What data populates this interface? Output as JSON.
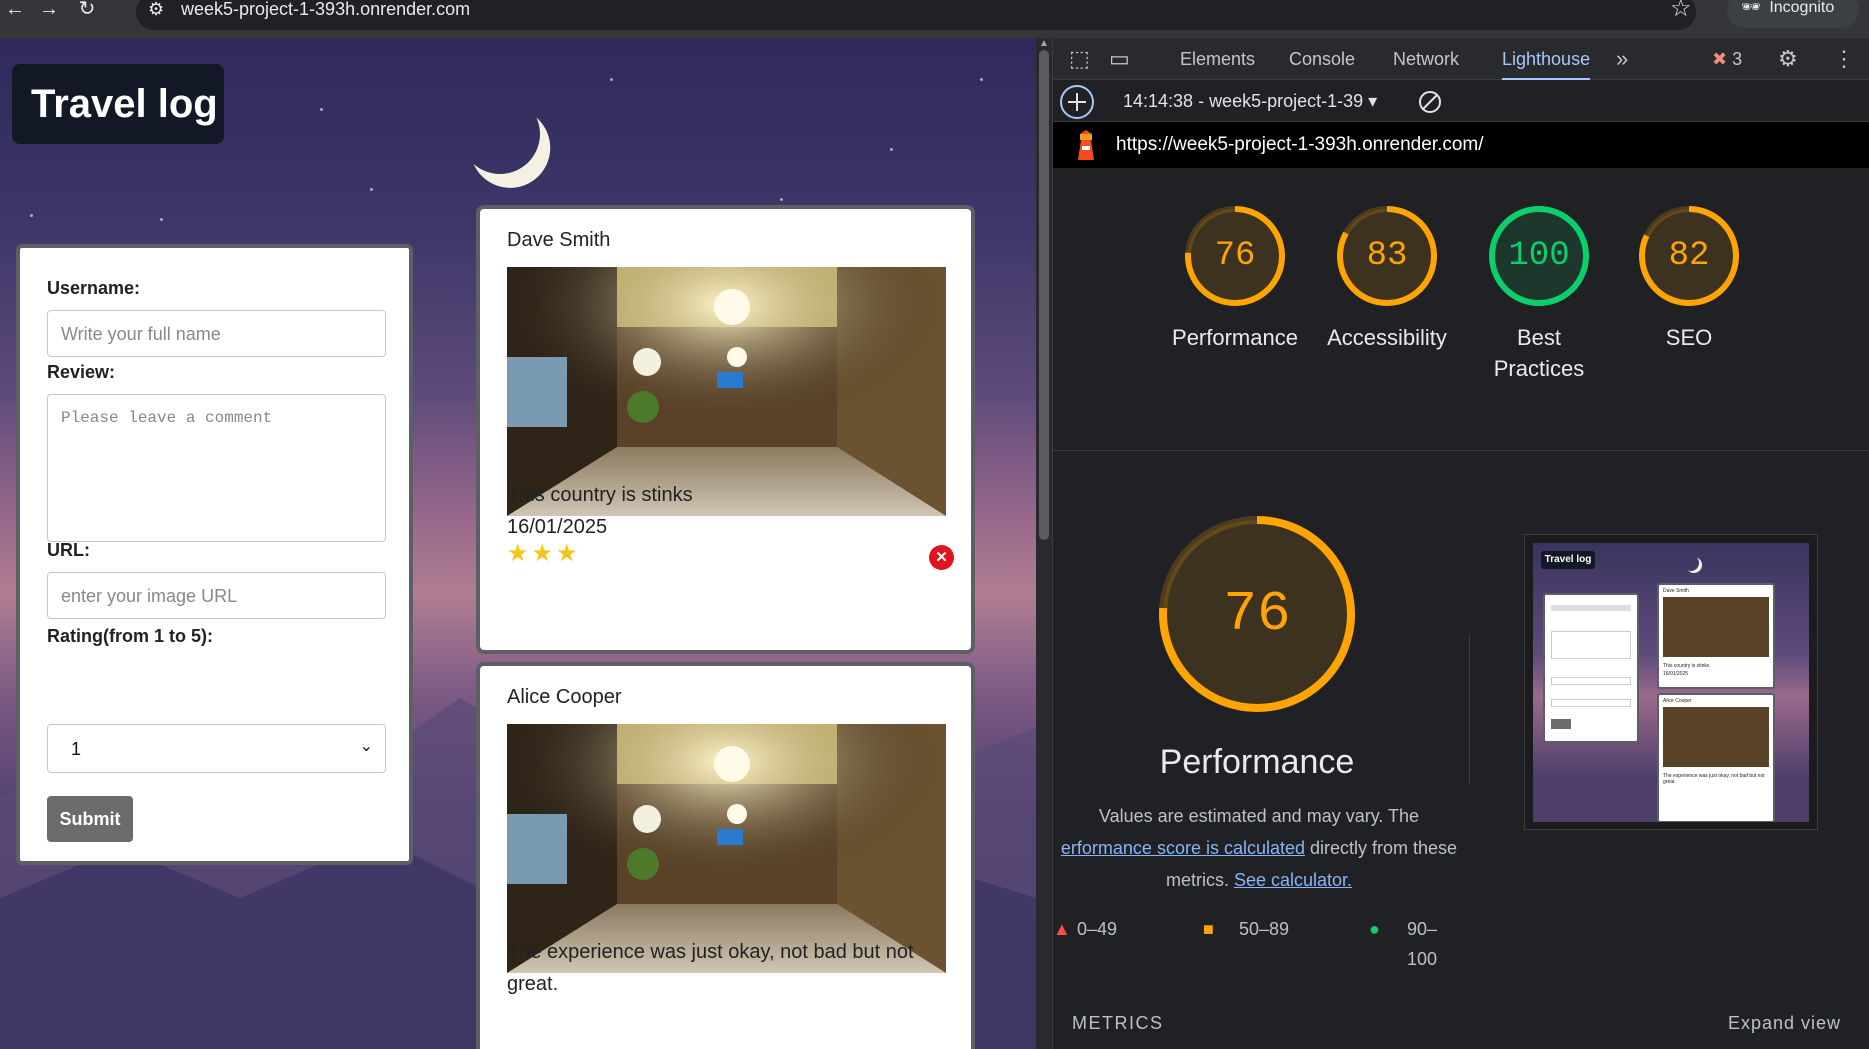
{
  "browser": {
    "url": "week5-project-1-393h.onrender.com",
    "incognito_label": "Incognito"
  },
  "page": {
    "title": "Travel log",
    "form": {
      "username_label": "Username:",
      "username_placeholder": "Write your full name",
      "review_label": "Review:",
      "review_placeholder": "Please leave a comment",
      "url_label": "URL:",
      "url_placeholder": "enter your image URL",
      "rating_label": "Rating(from 1 to 5):",
      "rating_value": "1",
      "submit_label": "Submit"
    },
    "reviews": [
      {
        "name": "Dave Smith",
        "text": "This country is stinks",
        "date": "16/01/2025",
        "stars": "★★★"
      },
      {
        "name": "Alice Cooper",
        "text": "The experience was just okay, not bad but not great.",
        "date": "",
        "stars": ""
      }
    ]
  },
  "devtools": {
    "tabs": [
      "Elements",
      "Console",
      "Network",
      "Lighthouse"
    ],
    "active_tab": "Lighthouse",
    "error_count": "3",
    "run_label": "14:14:38 - week5-project-1-39",
    "report_url": "https://week5-project-1-393h.onrender.com/",
    "scores": [
      {
        "value": "76",
        "label": "Performance",
        "color": "#ffa400",
        "fill": 0.76
      },
      {
        "value": "83",
        "label": "Accessibility",
        "color": "#ffa400",
        "fill": 0.83
      },
      {
        "value": "100",
        "label": "Best Practices",
        "color": "#0cce6b",
        "fill": 1.0
      },
      {
        "value": "82",
        "label": "SEO",
        "color": "#ffa400",
        "fill": 0.82
      }
    ],
    "performance": {
      "score": "76",
      "title": "Performance",
      "desc_1": "Values are estimated and may vary. The",
      "desc_link_1": "erformance score is calculated",
      "desc_2": " directly from these",
      "desc_3": "metrics. ",
      "desc_link_2": "See calculator."
    },
    "legend": {
      "fail": "0–49",
      "average": "50–89",
      "pass": "90–100"
    },
    "metrics_label": "METRICS",
    "expand_label": "Expand view",
    "thumbnail": {
      "title": "Travel log",
      "card1_name": "Dave Smith",
      "card1_text": "This country is stinks",
      "card1_date": "16/01/2025",
      "card2_name": "Alice Cooper",
      "card2_text": "The experience was just okay, not bad but not great."
    }
  },
  "colors": {
    "accent": "#a8c7fa",
    "average": "#ffa400",
    "pass": "#0cce6b",
    "fail": "#ff4e42"
  }
}
